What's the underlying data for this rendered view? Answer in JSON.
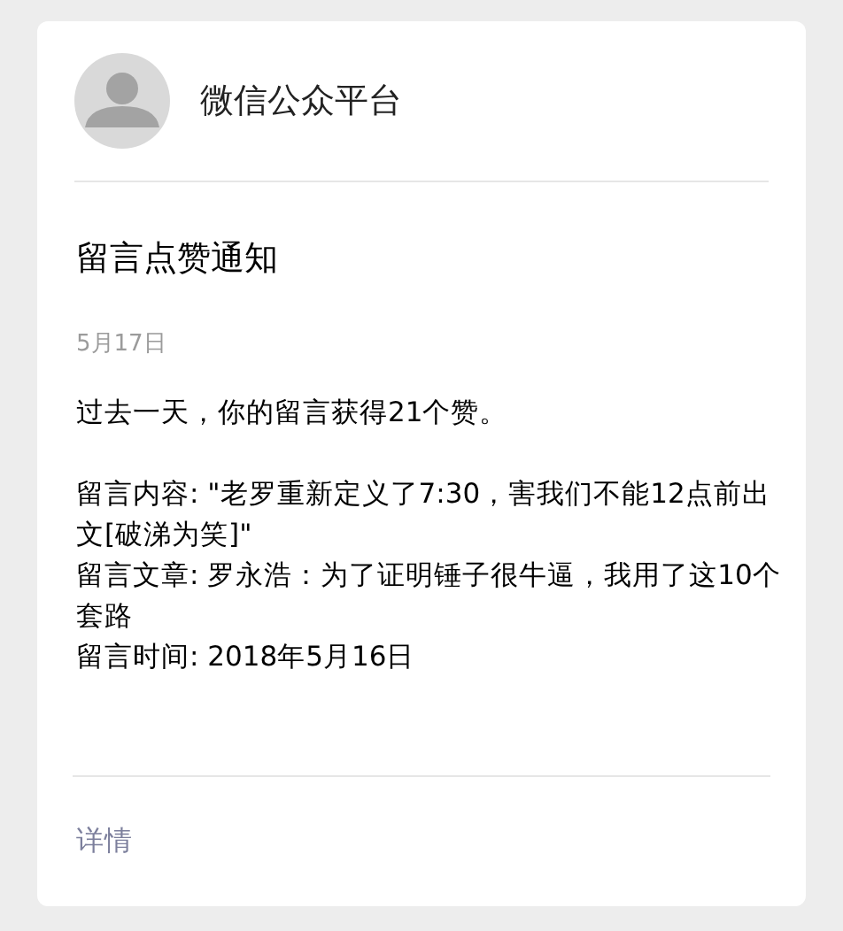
{
  "account": {
    "name": "微信公众平台"
  },
  "title": "留言点赞通知",
  "date": "5月17日",
  "summary": "过去一天，你的留言获得21个赞。",
  "details": [
    "留言内容: \"老罗重新定义了7:30，害我们不能12点前出文[破涕为笑]\"",
    "留言文章: 罗永浩：为了证明锤子很牛逼，我用了这10个套路",
    "留言时间: 2018年5月16日"
  ],
  "link": "详情"
}
